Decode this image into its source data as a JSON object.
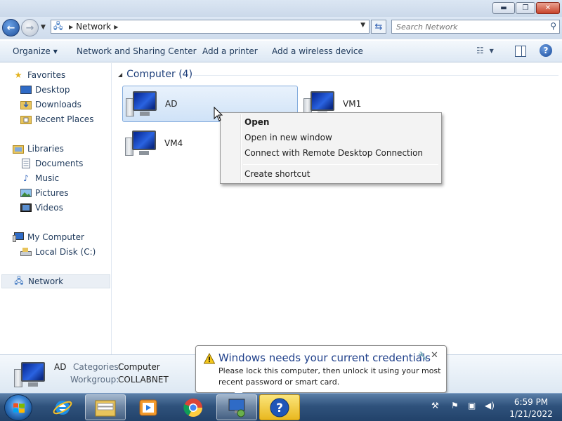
{
  "window": {
    "minimize_glyph": "▬",
    "maximize_glyph": "❐",
    "close_glyph": "✕"
  },
  "address": {
    "location": "Network",
    "search_placeholder": "Search Network"
  },
  "toolbar": {
    "organize": "Organize",
    "network_sharing": "Network and Sharing Center",
    "add_printer": "Add a printer",
    "add_wireless": "Add a wireless device"
  },
  "sidebar": {
    "favorites": "Favorites",
    "desktop": "Desktop",
    "downloads": "Downloads",
    "recent_places": "Recent Places",
    "libraries": "Libraries",
    "documents": "Documents",
    "music": "Music",
    "pictures": "Pictures",
    "videos": "Videos",
    "my_computer": "My Computer",
    "local_disk": "Local Disk (C:)",
    "network": "Network"
  },
  "content": {
    "group_header": "Computer (4)",
    "computers": [
      "AD",
      "VM1",
      "VM4"
    ]
  },
  "context_menu": {
    "open": "Open",
    "open_new_window": "Open in new window",
    "rdp": "Connect with Remote Desktop Connection",
    "create_shortcut": "Create shortcut"
  },
  "details": {
    "name": "AD",
    "categories_label": "Categories:",
    "categories_value": "Computer",
    "workgroup_label": "Workgroup:",
    "workgroup_value": "COLLABNET"
  },
  "notification": {
    "title": "Windows needs your current credentials",
    "line1": "Please lock this computer, then unlock it using your most",
    "line2": "recent password or smart card."
  },
  "taskbar": {
    "time": "6:59 PM",
    "date": "1/21/2022"
  },
  "colors": {
    "accent": "#1e3f7a",
    "selection": "#cfe2f7",
    "taskbar": "#2f527c"
  }
}
